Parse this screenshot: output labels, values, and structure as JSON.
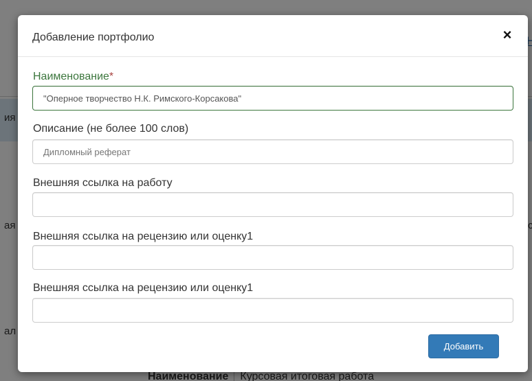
{
  "background": {
    "header_link_fragment": "Н",
    "left_fragments": [
      "ия",
      "ая",
      "ал"
    ],
    "right_fragments": [
      "с"
    ],
    "table_row": {
      "label": "Наименование",
      "value": "Курсовая итоговая работа"
    }
  },
  "modal": {
    "title": "Добавление портфолио",
    "close_symbol": "×",
    "fields": [
      {
        "label": "Наименование",
        "required_mark": "*",
        "value": "\"Оперное творчество Н.К. Римского-Корсакова\"",
        "placeholder": ""
      },
      {
        "label": "Описание (не более 100 слов)",
        "value": "",
        "placeholder": "Дипломный реферат"
      },
      {
        "label": "Внешняя ссылка на работу",
        "value": "",
        "placeholder": ""
      },
      {
        "label": "Внешняя ссылка на рецензию или оценку1",
        "value": "",
        "placeholder": ""
      },
      {
        "label": "Внешняя ссылка на рецензию или оценку1",
        "value": "",
        "placeholder": ""
      }
    ],
    "submit_label": "Добавить"
  },
  "colors": {
    "primary": "#337ab7",
    "success_label": "#3c763d",
    "required_star": "#a94442"
  }
}
